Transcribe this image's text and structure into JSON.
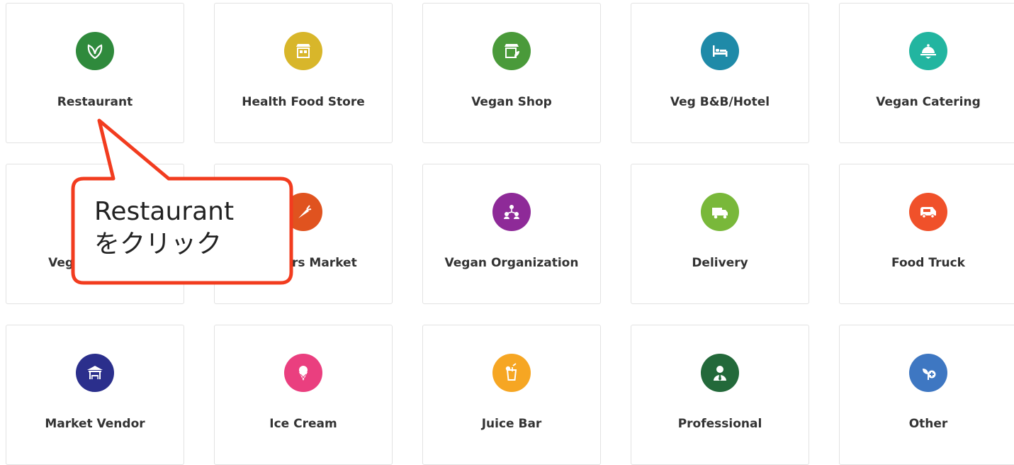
{
  "categories": [
    {
      "label": "Restaurant",
      "icon": "leaf-icon",
      "color": "#2f8a3c"
    },
    {
      "label": "Health Food Store",
      "icon": "storefront-icon",
      "color": "#d8b62a"
    },
    {
      "label": "Vegan Shop",
      "icon": "vegan-shop-icon",
      "color": "#4a9a3a"
    },
    {
      "label": "Veg B&B/Hotel",
      "icon": "bed-icon",
      "color": "#1f8aa8"
    },
    {
      "label": "Vegan Catering",
      "icon": "cloche-icon",
      "color": "#22b5a0"
    },
    {
      "label": "Vegan Bakery",
      "icon": "cake-icon",
      "color": "#c2187a"
    },
    {
      "label": "Farmers Market",
      "icon": "carrot-icon",
      "color": "#e0531f"
    },
    {
      "label": "Vegan Organization",
      "icon": "organization-icon",
      "color": "#8e2a98"
    },
    {
      "label": "Delivery",
      "icon": "delivery-truck-icon",
      "color": "#79b83a"
    },
    {
      "label": "Food Truck",
      "icon": "food-truck-icon",
      "color": "#f0512a"
    },
    {
      "label": "Market Vendor",
      "icon": "market-stall-icon",
      "color": "#2b2f8c"
    },
    {
      "label": "Ice Cream",
      "icon": "ice-cream-icon",
      "color": "#ea3f7f"
    },
    {
      "label": "Juice Bar",
      "icon": "juice-icon",
      "color": "#f6a623"
    },
    {
      "label": "Professional",
      "icon": "professional-icon",
      "color": "#23693a"
    },
    {
      "label": "Other",
      "icon": "plant-plus-icon",
      "color": "#3e77c2"
    }
  ],
  "callout": {
    "line1": "Restaurant",
    "line2": "をクリック",
    "border_color": "#f23c1f"
  }
}
